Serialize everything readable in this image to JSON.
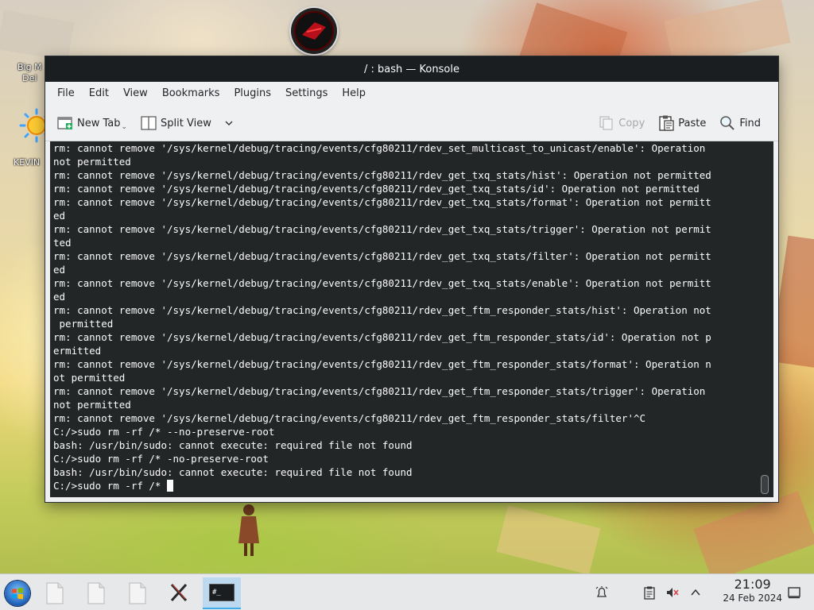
{
  "desktop": {
    "icons": [
      {
        "label": "Big M\nDel"
      },
      {
        "label": "KEVIN"
      }
    ]
  },
  "window": {
    "title": "/ : bash — Konsole",
    "menu": [
      "File",
      "Edit",
      "View",
      "Bookmarks",
      "Plugins",
      "Settings",
      "Help"
    ],
    "toolbar": {
      "new_tab": "New Tab",
      "split_view": "Split View",
      "copy": "Copy",
      "paste": "Paste",
      "find": "Find"
    },
    "terminal_lines": [
      "rm: cannot remove '/sys/kernel/debug/tracing/events/cfg80211/rdev_set_multicast_to_unicast/enable': Operation",
      "not permitted",
      "rm: cannot remove '/sys/kernel/debug/tracing/events/cfg80211/rdev_get_txq_stats/hist': Operation not permitted",
      "rm: cannot remove '/sys/kernel/debug/tracing/events/cfg80211/rdev_get_txq_stats/id': Operation not permitted",
      "rm: cannot remove '/sys/kernel/debug/tracing/events/cfg80211/rdev_get_txq_stats/format': Operation not permitt",
      "ed",
      "rm: cannot remove '/sys/kernel/debug/tracing/events/cfg80211/rdev_get_txq_stats/trigger': Operation not permit",
      "ted",
      "rm: cannot remove '/sys/kernel/debug/tracing/events/cfg80211/rdev_get_txq_stats/filter': Operation not permitt",
      "ed",
      "rm: cannot remove '/sys/kernel/debug/tracing/events/cfg80211/rdev_get_txq_stats/enable': Operation not permitt",
      "ed",
      "rm: cannot remove '/sys/kernel/debug/tracing/events/cfg80211/rdev_get_ftm_responder_stats/hist': Operation not",
      " permitted",
      "rm: cannot remove '/sys/kernel/debug/tracing/events/cfg80211/rdev_get_ftm_responder_stats/id': Operation not p",
      "ermitted",
      "rm: cannot remove '/sys/kernel/debug/tracing/events/cfg80211/rdev_get_ftm_responder_stats/format': Operation n",
      "ot permitted",
      "rm: cannot remove '/sys/kernel/debug/tracing/events/cfg80211/rdev_get_ftm_responder_stats/trigger': Operation",
      "not permitted",
      "rm: cannot remove '/sys/kernel/debug/tracing/events/cfg80211/rdev_get_ftm_responder_stats/filter'^C",
      "C:/>sudo rm -rf /* --no-preserve-root",
      "bash: /usr/bin/sudo: cannot execute: required file not found",
      "C:/>sudo rm -rf /* -no-preserve-root",
      "bash: /usr/bin/sudo: cannot execute: required file not found",
      "C:/>sudo rm -rf /* "
    ]
  },
  "taskbar": {
    "konsole_label": "#_",
    "clock_time": "21:09",
    "clock_date": "24 Feb 2024"
  },
  "colors": {
    "terminal_bg": "#232627",
    "titlebar_bg": "#1b1e20",
    "accent": "#3daee9"
  }
}
